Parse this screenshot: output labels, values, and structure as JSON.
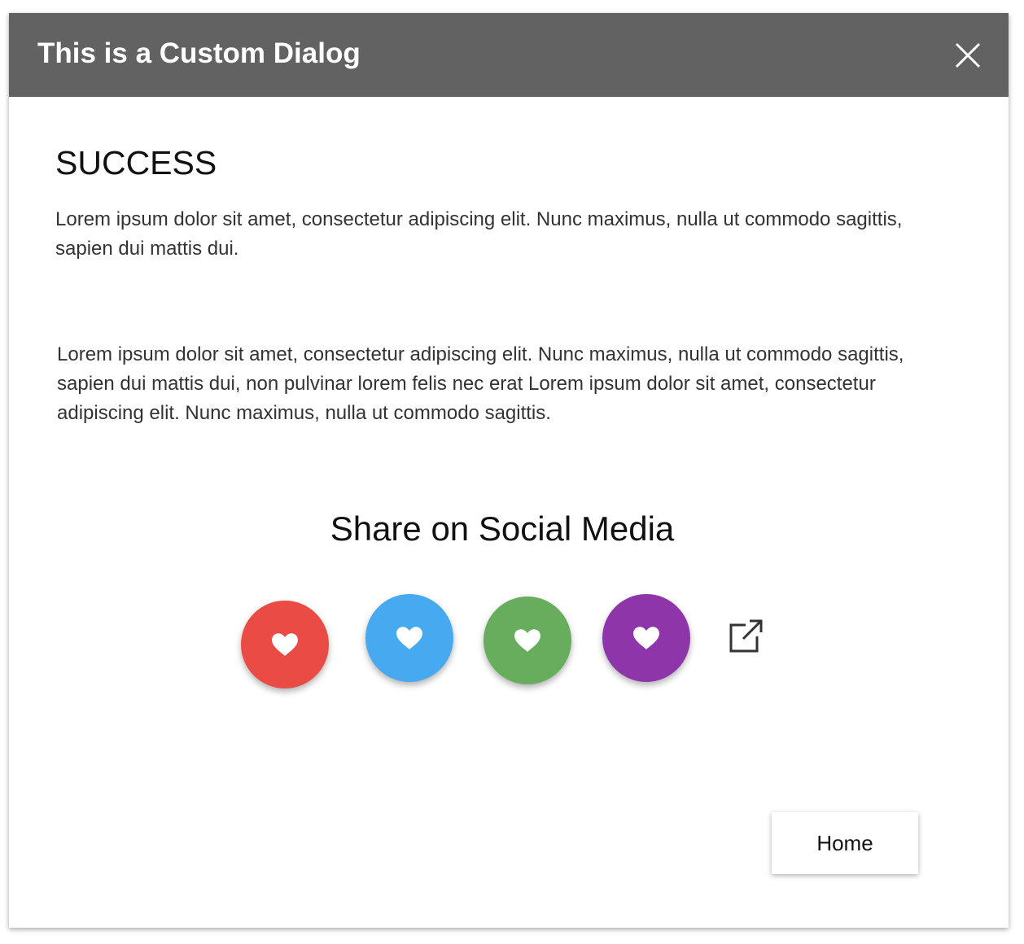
{
  "dialog": {
    "title": "This is a Custom Dialog",
    "close_icon": "close-icon"
  },
  "content": {
    "heading": "SUCCESS",
    "paragraph1": "Lorem ipsum dolor sit amet, consectetur adipiscing elit. Nunc maximus, nulla ut commodo sagittis, sapien dui mattis dui.",
    "paragraph2": "Lorem ipsum dolor sit amet, consectetur adipiscing elit. Nunc maximus, nulla ut commodo sagittis, sapien dui mattis dui, non pulvinar lorem felis nec erat Lorem ipsum dolor sit amet, consectetur adipiscing elit. Nunc maximus, nulla ut commodo sagittis."
  },
  "share": {
    "title": "Share on Social Media",
    "buttons": [
      {
        "icon": "heart-icon",
        "color": "#EA4B44"
      },
      {
        "icon": "heart-icon",
        "color": "#47A9EF"
      },
      {
        "icon": "heart-icon",
        "color": "#68AC5D"
      },
      {
        "icon": "heart-icon",
        "color": "#8E36A9"
      }
    ],
    "external_icon": "external-link-icon"
  },
  "footer": {
    "home_label": "Home"
  },
  "colors": {
    "header_bg": "#626262",
    "header_text": "#FFFFFF"
  }
}
